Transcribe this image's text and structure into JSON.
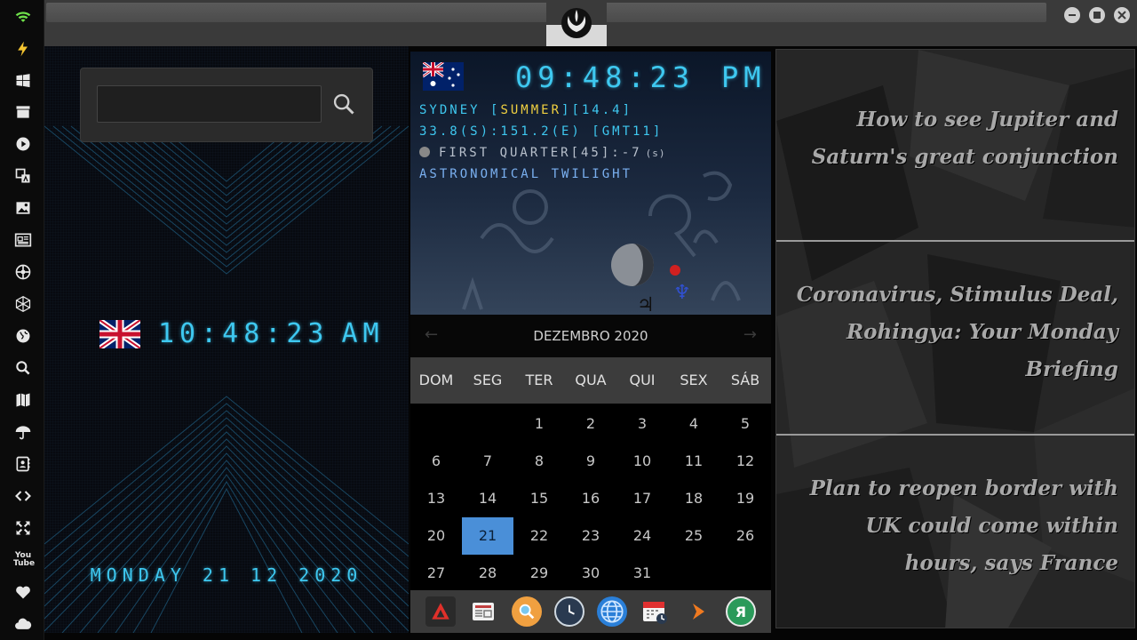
{
  "rail": {
    "icons": [
      "wifi-icon",
      "power-icon",
      "windows-icon",
      "archive-icon",
      "play-icon",
      "translate-icon",
      "image-icon",
      "newspaper-icon",
      "rebel-icon",
      "hexagon-icon",
      "globe-icon",
      "search-icon",
      "map-icon",
      "umbrella-icon",
      "contacts-icon",
      "code-icon",
      "expand-icon",
      "youtube-icon",
      "heart-icon",
      "cloud-icon"
    ],
    "youtube_label": "You Tube"
  },
  "left": {
    "search": {
      "value": "",
      "placeholder": ""
    },
    "clock_time": "10:48:23",
    "clock_ampm": "AM",
    "date": "MONDAY 21 12 2020"
  },
  "astro": {
    "time": "09:48:23",
    "ampm": "PM",
    "line1_a": "SYDNEY [",
    "line1_season": "SUMMER",
    "line1_b": "][14.4]",
    "line2": "33.8(S):151.2(E) [GMT11]",
    "line3": "FIRST QUARTER[45]:-7",
    "line3_unit": "(s)",
    "line4": "ASTRONOMICAL TWILIGHT"
  },
  "calendar": {
    "month": "DEZEMBRO 2020",
    "prev": "←",
    "next": "→",
    "weekdays": [
      "DOM",
      "SEG",
      "TER",
      "QUA",
      "QUI",
      "SEX",
      "SÁB"
    ],
    "rows": [
      [
        "",
        "",
        "1",
        "2",
        "3",
        "4",
        "5"
      ],
      [
        "6",
        "7",
        "8",
        "9",
        "10",
        "11",
        "12"
      ],
      [
        "13",
        "14",
        "15",
        "16",
        "17",
        "18",
        "19"
      ],
      [
        "20",
        "21",
        "22",
        "23",
        "24",
        "25",
        "26"
      ],
      [
        "27",
        "28",
        "29",
        "30",
        "31",
        "",
        ""
      ]
    ],
    "today": "21"
  },
  "dock": {
    "items": [
      {
        "name": "app-red-icon",
        "label": ""
      },
      {
        "name": "news-app-icon",
        "label": ""
      },
      {
        "name": "search-app-icon",
        "label": ""
      },
      {
        "name": "clock-app-icon",
        "label": ""
      },
      {
        "name": "globe-app-icon",
        "label": ""
      },
      {
        "name": "calendar-app-icon",
        "label": ""
      },
      {
        "name": "play-app-icon",
        "label": ""
      },
      {
        "name": "yandex-app-icon",
        "label": "Я"
      }
    ]
  },
  "news": {
    "headlines": [
      "How to see Jupiter and Saturn's great conjunction",
      "Coronavirus, Stimulus Deal, Rohingya: Your Monday Briefing",
      "Plan to reopen border with UK could come within hours, says France"
    ]
  },
  "colors": {
    "accent": "#3ec8f0",
    "today": "#4a8fd8",
    "season": "#f0d040"
  }
}
